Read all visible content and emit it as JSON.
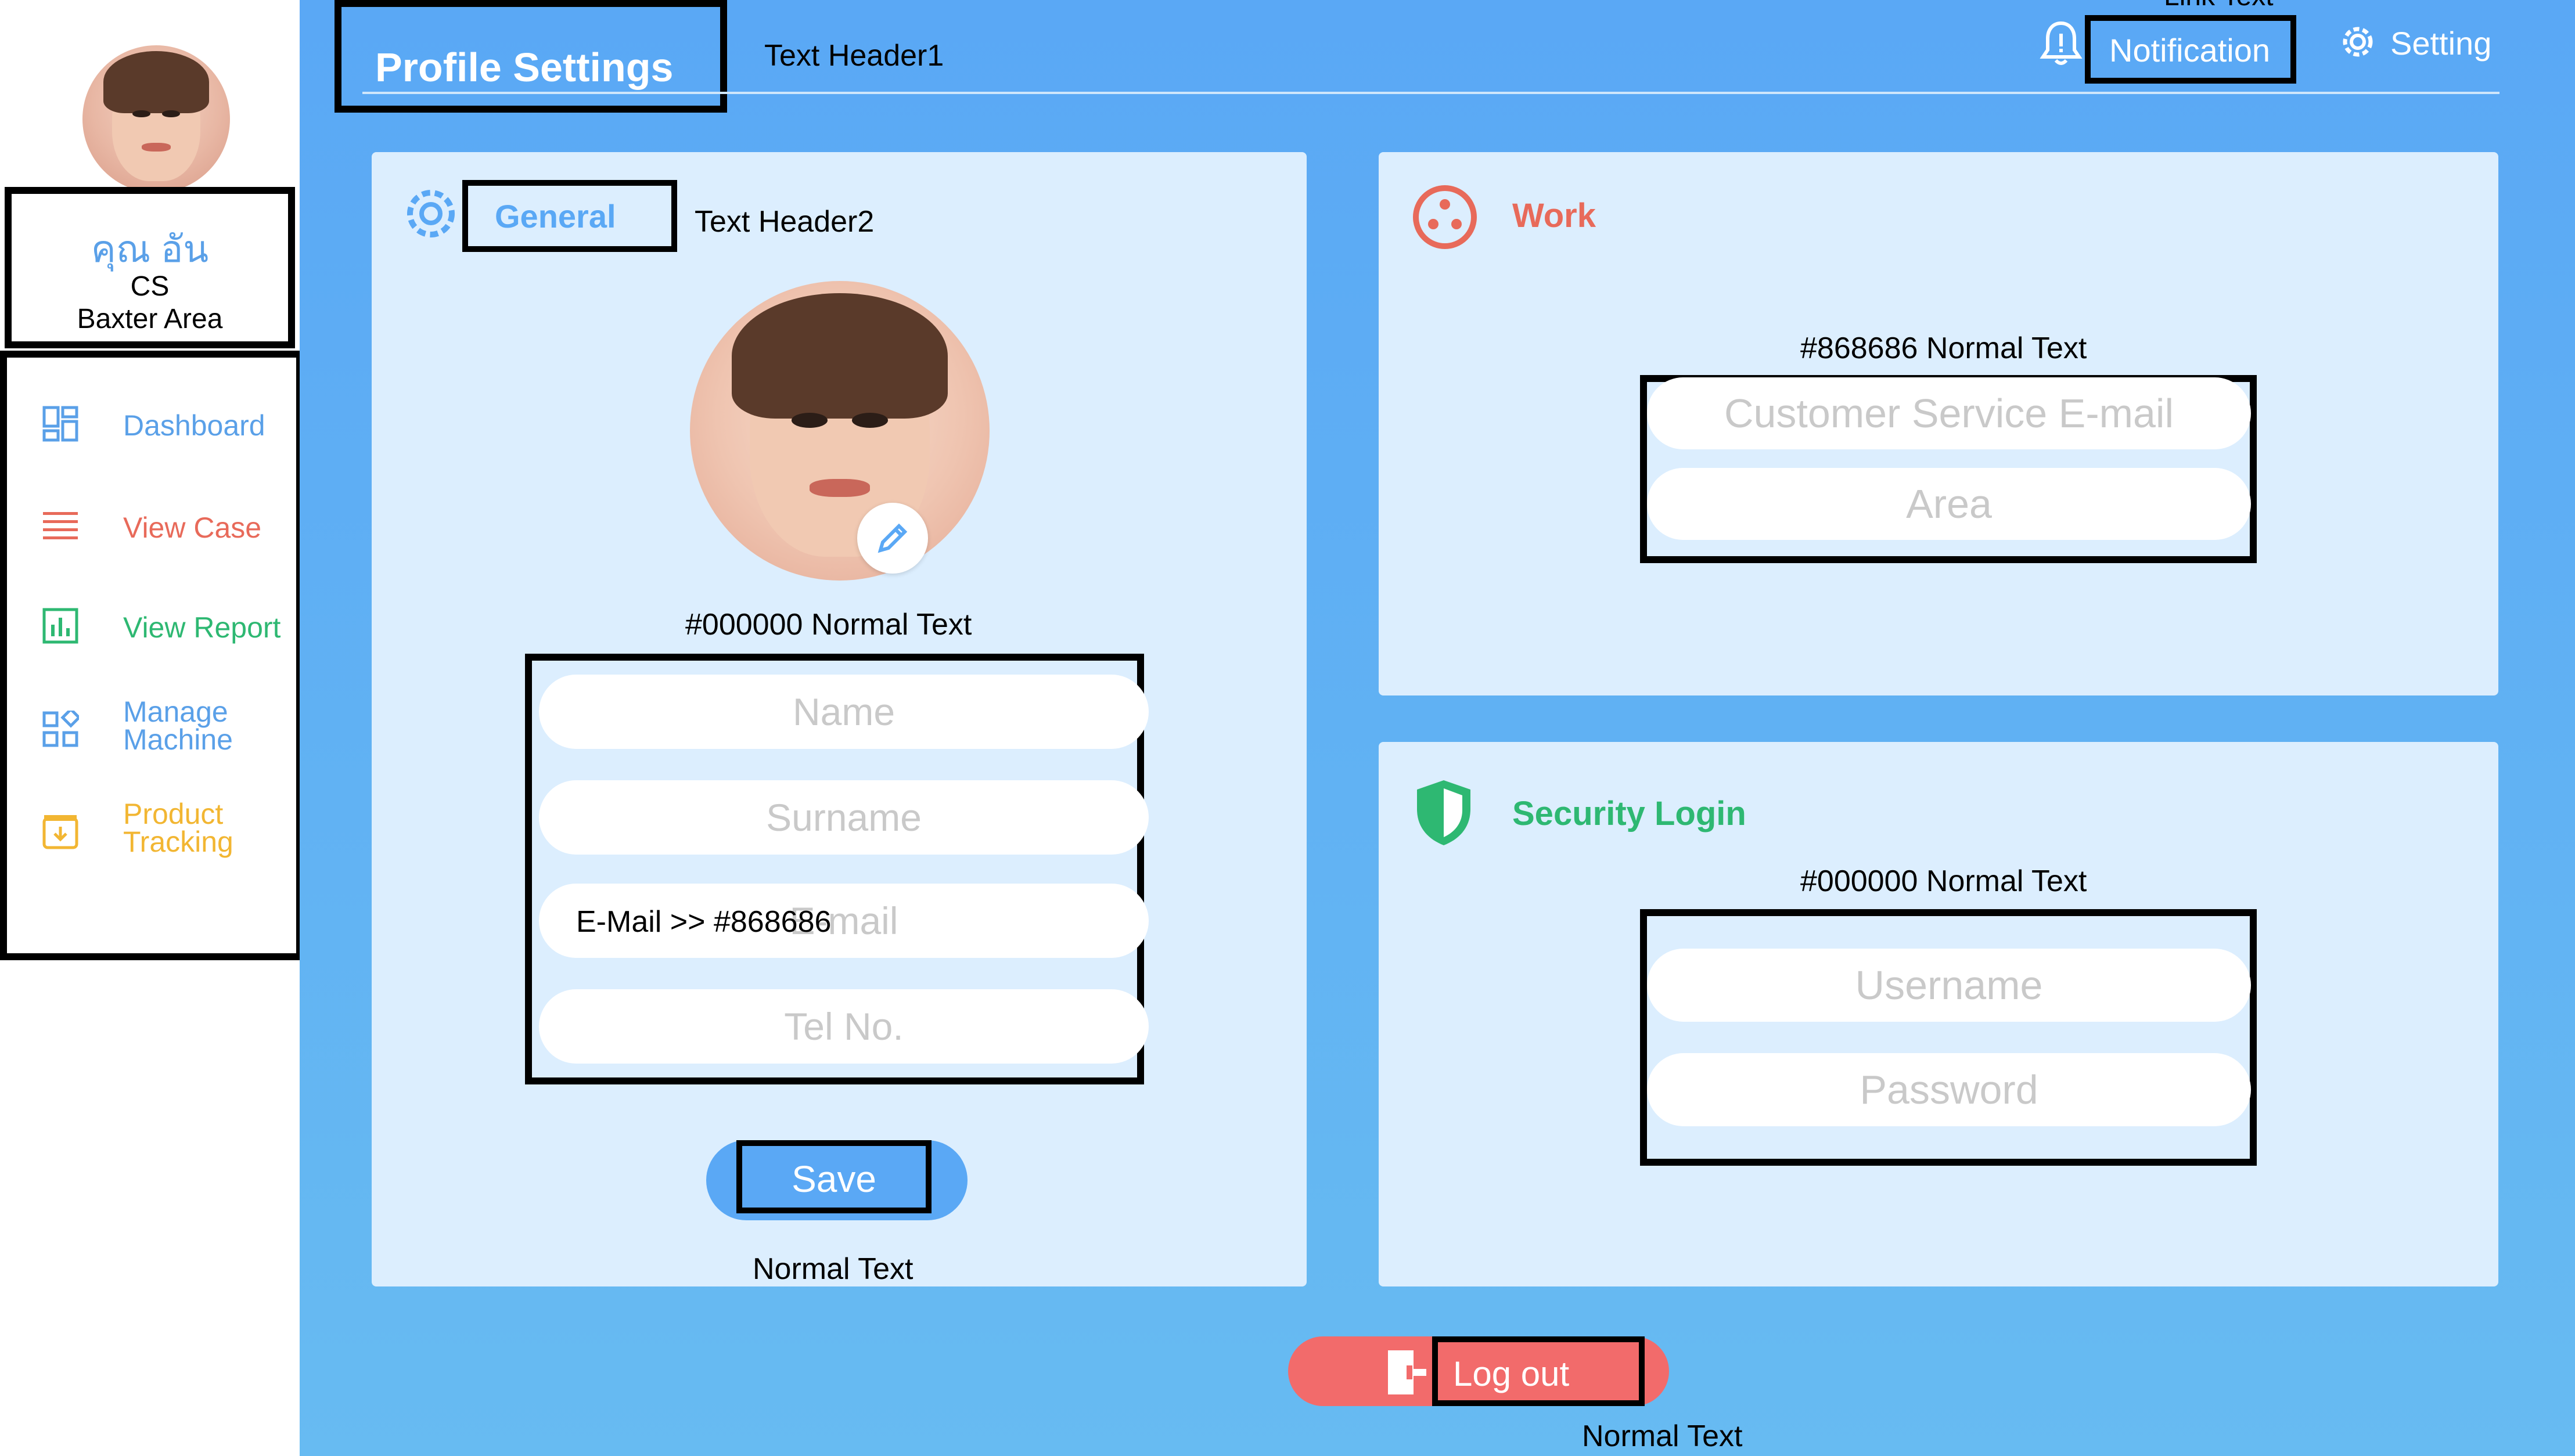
{
  "sidebar": {
    "user_name": "คุณ อัน",
    "user_role": "CS",
    "user_area": "Baxter Area",
    "items": [
      {
        "label": "Dashboard",
        "color": "#5aa0e8",
        "icon": "dashboard-icon"
      },
      {
        "label": "View Case",
        "color": "#e86a5a",
        "icon": "list-icon"
      },
      {
        "label": "View Report",
        "color": "#2eb872",
        "icon": "report-icon"
      },
      {
        "label": "Manage\nMachine",
        "color": "#5aa0e8",
        "icon": "manage-icon"
      },
      {
        "label": "Product\nTracking",
        "color": "#f2b632",
        "icon": "tracking-icon"
      }
    ]
  },
  "header": {
    "title": "Profile Settings",
    "text_header1": "Text Header1",
    "notification": "Notification",
    "setting": "Setting",
    "link_text": "Link Text"
  },
  "general": {
    "title": "General",
    "text_header2": "Text Header2",
    "note": "#000000  Normal Text",
    "email_note": "E-Mail >> #868686",
    "fields": {
      "name": "Name",
      "surname": "Surname",
      "email": "E-mail",
      "tel": "Tel No."
    },
    "save": "Save",
    "save_note": "Normal Text"
  },
  "work": {
    "title": "Work",
    "note": "#868686  Normal Text",
    "fields": {
      "cs_email": "Customer Service E-mail",
      "area": "Area"
    }
  },
  "security": {
    "title": "Security Login",
    "note": "#000000  Normal Text",
    "fields": {
      "username": "Username",
      "password": "Password"
    }
  },
  "logout": {
    "label": "Log out",
    "note": "Normal Text"
  },
  "colors": {
    "main_bg": "#5aa8f5",
    "card_bg": "#dceefe",
    "logout_bg": "#f26b6b",
    "placeholder": "#c9c9c9"
  }
}
